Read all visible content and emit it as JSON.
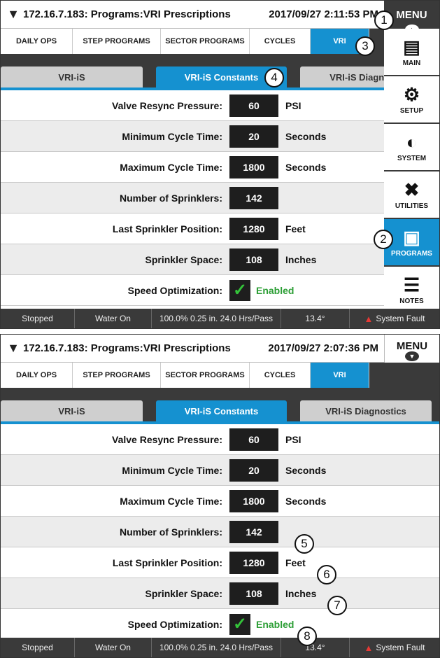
{
  "top": {
    "title": "172.16.7.183: Programs:VRI Prescriptions",
    "clock": "2017/09/27 2:11:53 PM",
    "menu_label": "MENU",
    "nav_tabs": [
      "DAILY OPS",
      "STEP PROGRAMS",
      "SECTOR PROGRAMS",
      "CYCLES",
      "VRI"
    ],
    "sub_tabs": [
      "VRI-iS",
      "VRI-iS Constants",
      "VRI-iS Diagnostics"
    ],
    "sidebar": [
      "MAIN",
      "SETUP",
      "SYSTEM",
      "UTILITIES",
      "PROGRAMS",
      "NOTES"
    ],
    "callouts": [
      "1",
      "2",
      "3",
      "4"
    ]
  },
  "bottom": {
    "title": "172.16.7.183: Programs:VRI Prescriptions",
    "clock": "2017/09/27 2:07:36 PM",
    "menu_label": "MENU",
    "nav_tabs": [
      "DAILY OPS",
      "STEP PROGRAMS",
      "SECTOR PROGRAMS",
      "CYCLES",
      "VRI"
    ],
    "sub_tabs": [
      "VRI-iS",
      "VRI-iS Constants",
      "VRI-iS Diagnostics"
    ],
    "callouts": [
      "5",
      "6",
      "7",
      "8"
    ]
  },
  "fields": {
    "valve_resync_pressure": {
      "label": "Valve Resync Pressure:",
      "value": "60",
      "unit": "PSI"
    },
    "min_cycle_time": {
      "label": "Minimum Cycle Time:",
      "value": "20",
      "unit": "Seconds"
    },
    "max_cycle_time": {
      "label": "Maximum Cycle Time:",
      "value": "1800",
      "unit": "Seconds"
    },
    "num_sprinklers": {
      "label": "Number of Sprinklers:",
      "value": "142",
      "unit": ""
    },
    "last_sprinkler_position": {
      "label": "Last Sprinkler Position:",
      "value": "1280",
      "unit": "Feet"
    },
    "sprinkler_space": {
      "label": "Sprinkler Space:",
      "value": "108",
      "unit": "Inches"
    },
    "speed_optimization": {
      "label": "Speed Optimization:",
      "state": "Enabled"
    }
  },
  "status": {
    "state": "Stopped",
    "water": "Water On",
    "rate": "100.0%  0.25 in.  24.0 Hrs/Pass",
    "angle": "13.4°",
    "fault": "System Fault"
  },
  "icons": {
    "logo": "pivot-logo-icon",
    "main": "main-dashboard-icon",
    "setup": "gear-icon",
    "system": "system-gauge-icon",
    "utilities": "tools-icon",
    "programs": "floppy-disk-icon",
    "notes": "notes-icon",
    "warning": "warning-triangle-icon",
    "check": "checkmark-icon"
  },
  "colors": {
    "accent": "#1591d0",
    "dark": "#3a3a3a",
    "enabled": "#2c9e35",
    "fault": "#e53935"
  }
}
